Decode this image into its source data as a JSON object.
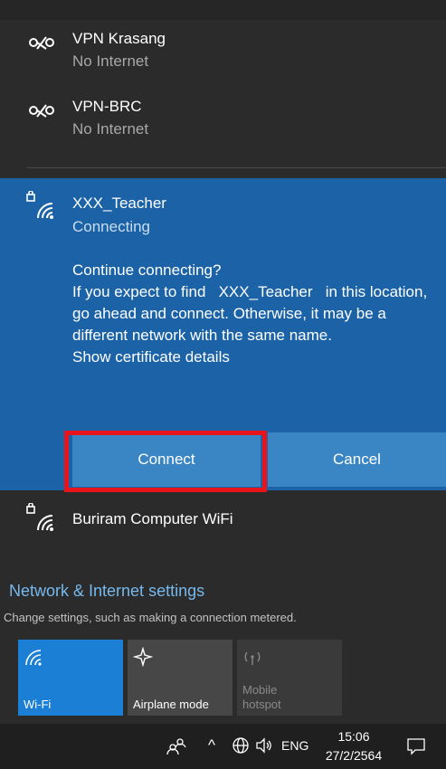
{
  "networks": [
    {
      "name": "VPN Krasang",
      "status": "No Internet"
    },
    {
      "name": "VPN-BRC",
      "status": "No Internet"
    }
  ],
  "selected": {
    "name": "XXX_Teacher",
    "status": "Connecting",
    "prompt": "Continue connecting?",
    "message_pre": "If you expect to find",
    "message_network": "XXX_Teacher",
    "message_post": "in this location, go ahead and connect. Otherwise, it may be a different network with the same name.",
    "cert_link": "Show certificate details",
    "connect_label": "Connect",
    "cancel_label": "Cancel"
  },
  "other_network": {
    "name": "Buriram Computer WiFi"
  },
  "settings": {
    "title": "Network & Internet settings",
    "desc": "Change settings, such as making a connection metered."
  },
  "quick_actions": [
    {
      "label": "Wi-Fi",
      "icon": "wifi-icon",
      "active": true
    },
    {
      "label": "Airplane mode",
      "icon": "airplane-icon",
      "active": false
    },
    {
      "label": "Mobile hotspot",
      "icon": "hotspot-icon",
      "active": false
    }
  ],
  "taskbar": {
    "lang": "ENG",
    "time": "15:06",
    "date": "27/2/2564"
  },
  "colors": {
    "accent": "#1b63a6",
    "highlight": "#e8141b",
    "link": "#76b9ed"
  }
}
